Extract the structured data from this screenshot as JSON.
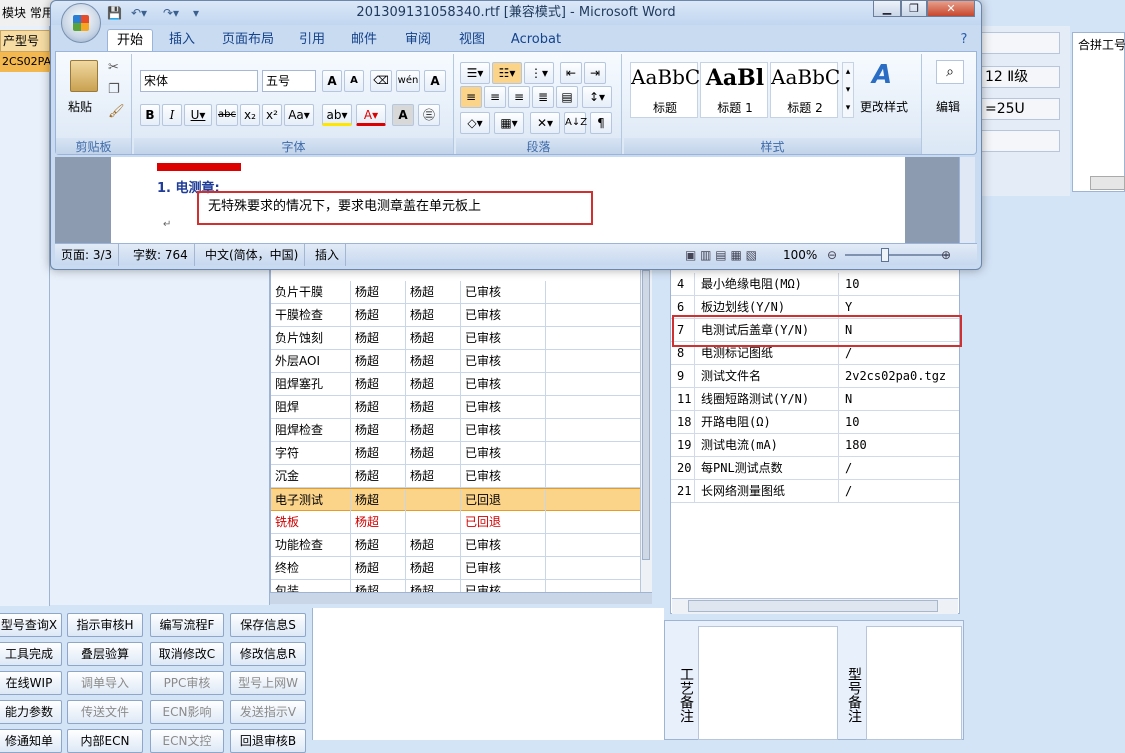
{
  "background_app": {
    "menu": "模块 常用",
    "left_header": "产型号",
    "left_selected_row": "2CS02PA0",
    "right_fields": [
      "",
      "12 Ⅱ级",
      "=25U",
      ""
    ],
    "right_merge_label": "合拼工号",
    "process_table": {
      "rows": [
        {
          "step": "负片干膜",
          "c1": "杨超",
          "c2": "杨超",
          "status": "已审核",
          "state": "normal"
        },
        {
          "step": "干膜检查",
          "c1": "杨超",
          "c2": "杨超",
          "status": "已审核",
          "state": "normal"
        },
        {
          "step": "负片蚀刻",
          "c1": "杨超",
          "c2": "杨超",
          "status": "已审核",
          "state": "normal"
        },
        {
          "step": "外层AOI",
          "c1": "杨超",
          "c2": "杨超",
          "status": "已审核",
          "state": "normal"
        },
        {
          "step": "阻焊塞孔",
          "c1": "杨超",
          "c2": "杨超",
          "status": "已审核",
          "state": "normal"
        },
        {
          "step": "阻焊",
          "c1": "杨超",
          "c2": "杨超",
          "status": "已审核",
          "state": "normal"
        },
        {
          "step": "阻焊检查",
          "c1": "杨超",
          "c2": "杨超",
          "status": "已审核",
          "state": "normal"
        },
        {
          "step": "字符",
          "c1": "杨超",
          "c2": "杨超",
          "status": "已审核",
          "state": "normal"
        },
        {
          "step": "沉金",
          "c1": "杨超",
          "c2": "杨超",
          "status": "已审核",
          "state": "normal"
        },
        {
          "step": "电子测试",
          "c1": "杨超",
          "c2": "",
          "status": "已回退",
          "state": "selected"
        },
        {
          "step": "铣板",
          "c1": "杨超",
          "c2": "",
          "status": "已回退",
          "state": "red"
        },
        {
          "step": "功能检查",
          "c1": "杨超",
          "c2": "杨超",
          "status": "已审核",
          "state": "normal"
        },
        {
          "step": "终检",
          "c1": "杨超",
          "c2": "杨超",
          "status": "已审核",
          "state": "normal"
        },
        {
          "step": "包装",
          "c1": "杨超",
          "c2": "杨超",
          "status": "已审核",
          "state": "normal"
        }
      ]
    },
    "param_table": {
      "rows": [
        {
          "no": "4",
          "name": "最小绝缘电阻(MΩ)",
          "value": "10"
        },
        {
          "no": "6",
          "name": "板边划线(Y/N)",
          "value": "Y"
        },
        {
          "no": "7",
          "name": "电测试后盖章(Y/N)",
          "value": "N"
        },
        {
          "no": "8",
          "name": "电测标记图纸",
          "value": "/"
        },
        {
          "no": "9",
          "name": "测试文件名",
          "value": "2v2cs02pa0.tgz"
        },
        {
          "no": "11",
          "name": "线圈短路测试(Y/N)",
          "value": "N"
        },
        {
          "no": "18",
          "name": "开路电阻(Ω)",
          "value": "10"
        },
        {
          "no": "19",
          "name": "测试电流(mA)",
          "value": "180"
        },
        {
          "no": "20",
          "name": "每PNL测试点数",
          "value": "/"
        },
        {
          "no": "21",
          "name": "长网络测量图纸",
          "value": "/"
        }
      ]
    },
    "buttons": [
      {
        "label": "型号查询X",
        "enabled": true
      },
      {
        "label": "指示审核H",
        "enabled": true
      },
      {
        "label": "编写流程F",
        "enabled": true
      },
      {
        "label": "保存信息S",
        "enabled": true
      },
      {
        "label": "工具完成",
        "enabled": true
      },
      {
        "label": "叠层验算",
        "enabled": true
      },
      {
        "label": "取消修改C",
        "enabled": true
      },
      {
        "label": "修改信息R",
        "enabled": true
      },
      {
        "label": "在线WIP",
        "enabled": true
      },
      {
        "label": "调单导入",
        "enabled": false
      },
      {
        "label": "PPC审核",
        "enabled": false
      },
      {
        "label": "型号上网W",
        "enabled": false
      },
      {
        "label": "能力参数",
        "enabled": true
      },
      {
        "label": "传送文件",
        "enabled": false
      },
      {
        "label": "ECN影响",
        "enabled": false
      },
      {
        "label": "发送指示V",
        "enabled": false
      },
      {
        "label": "修通知单",
        "enabled": true
      },
      {
        "label": "内部ECN",
        "enabled": true
      },
      {
        "label": "ECN文控",
        "enabled": false
      },
      {
        "label": "回退审核B",
        "enabled": true
      }
    ],
    "remarks": {
      "craft": "工艺备注",
      "model": "型号备注"
    }
  },
  "word": {
    "title": "201309131058340.rtf [兼容模式] - Microsoft Word",
    "tabs": [
      "开始",
      "插入",
      "页面布局",
      "引用",
      "邮件",
      "审阅",
      "视图",
      "Acrobat"
    ],
    "ribbon": {
      "clipboard": {
        "label": "剪贴板",
        "paste": "粘贴"
      },
      "font": {
        "label": "字体",
        "name": "宋体",
        "size": "五号"
      },
      "paragraph": {
        "label": "段落"
      },
      "styles": {
        "label": "样式",
        "items": [
          {
            "sample": "AaBbC",
            "name": "标题"
          },
          {
            "sample": "AaBl",
            "name": "标题 1"
          },
          {
            "sample": "AaBbC",
            "name": "标题 2"
          }
        ],
        "change": "更改样式"
      },
      "editing": {
        "label": "编辑"
      }
    },
    "document": {
      "heading": "1. 电测章:",
      "text": "无特殊要求的情况下，要求电测章盖在单元板上"
    },
    "status": {
      "page": "页面: 3/3",
      "words": "字数: 764",
      "lang": "中文(简体，中国)",
      "mode": "插入",
      "zoom": "100%"
    }
  }
}
